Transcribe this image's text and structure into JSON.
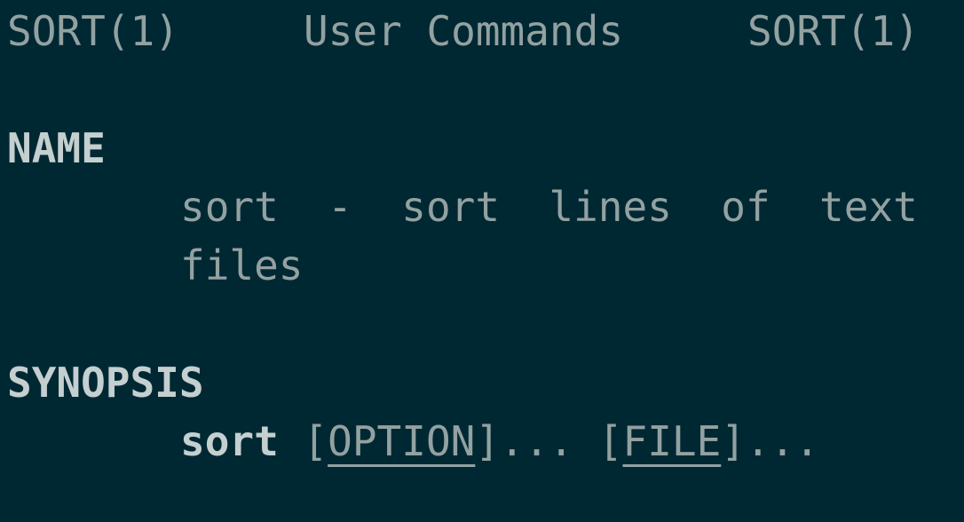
{
  "colors": {
    "background": "#002833",
    "text": "#93a1a1",
    "bold": "#c4cfcf"
  },
  "header": {
    "left": "SORT(1)",
    "center": "User Commands",
    "right": "SORT(1)"
  },
  "name": {
    "heading": "NAME",
    "line1": "sort  -  sort  lines  of  text",
    "line2": "files"
  },
  "synopsis": {
    "heading": "SYNOPSIS",
    "command": "sort",
    "open1": " [",
    "arg1": "OPTION",
    "close1": "]... [",
    "arg2": "FILE",
    "close2": "]..."
  }
}
